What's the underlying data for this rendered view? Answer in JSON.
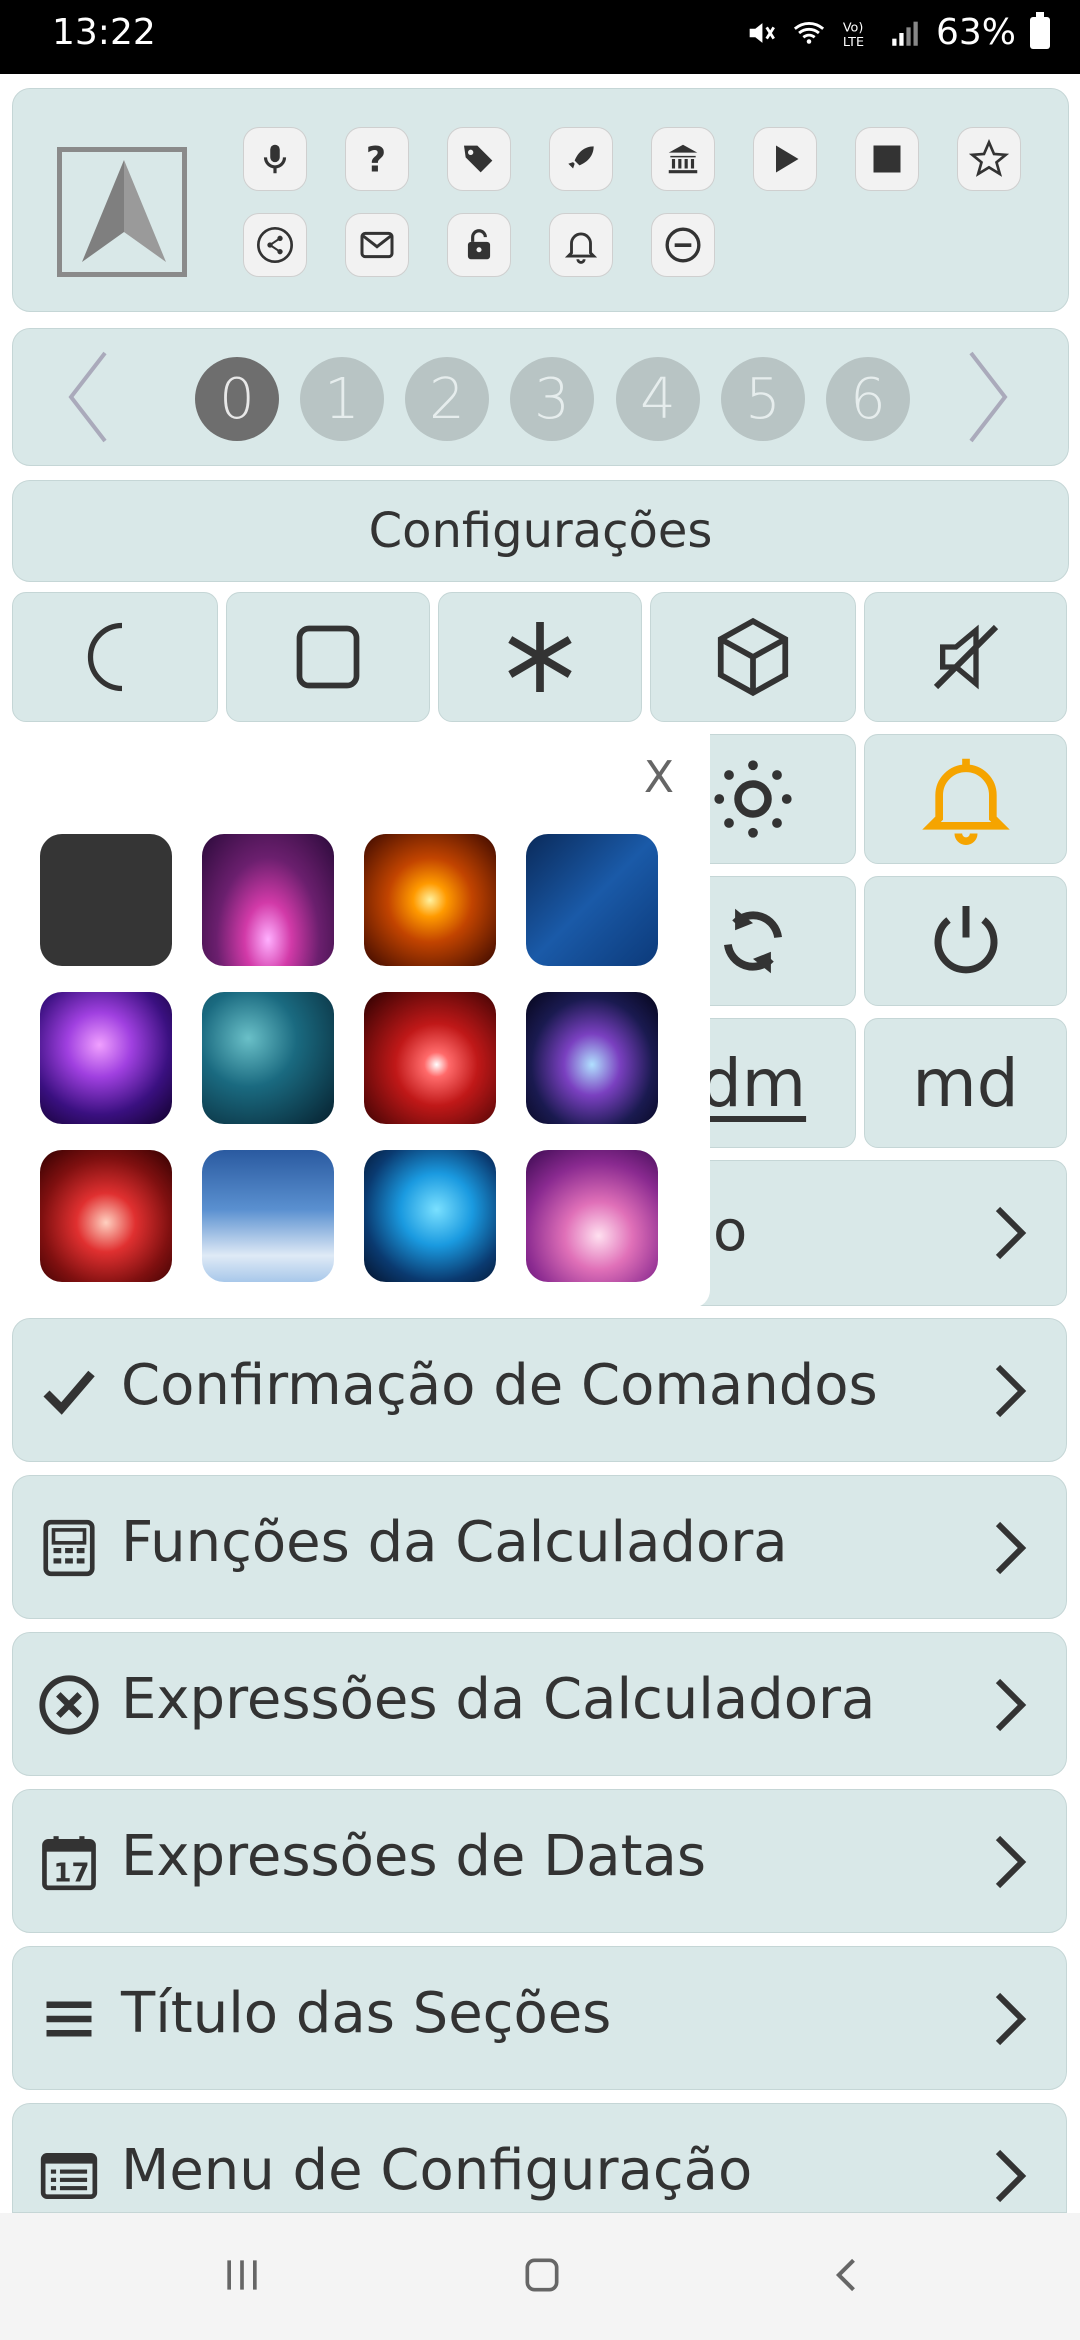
{
  "status_bar": {
    "time": "13:22",
    "battery": "63%"
  },
  "toolbar": {
    "icons": [
      "mic-icon",
      "help-icon",
      "tag-icon",
      "rocket-icon",
      "bank-icon",
      "play-icon",
      "stop-icon",
      "star-icon",
      "share-icon",
      "mail-icon",
      "unlock-icon",
      "bell-icon",
      "minus-circle-icon"
    ]
  },
  "pager": {
    "pages": [
      "0",
      "1",
      "2",
      "3",
      "4",
      "5",
      "6"
    ],
    "active": "0"
  },
  "section_title": "Configurações",
  "quick_tiles": {
    "row1": [
      "moon-icon",
      "square-icon",
      "asterisk-icon",
      "cube-icon",
      "mute-icon"
    ],
    "sun_icon": "sun-icon",
    "bell_icon": "bell-icon",
    "sync_icon": "sync-icon",
    "power_icon": "power-icon",
    "dm_label": "dm",
    "md_label": "md",
    "partial_row_text": "o"
  },
  "popup": {
    "close_label": "X",
    "swatches": [
      "dark-gray",
      "magenta-nebula",
      "orange-flare",
      "blue-polygon",
      "violet-glow",
      "teal-bokeh",
      "red-sparkle",
      "galaxy",
      "red-bokeh",
      "sky-clouds",
      "cyan-abstract",
      "pink-blur"
    ]
  },
  "menu": [
    {
      "icon": "check-icon",
      "label": "Confirmação de Comandos"
    },
    {
      "icon": "calculator-icon",
      "label": "Funções da Calculadora"
    },
    {
      "icon": "x-circle-icon",
      "label": "Expressões da Calculadora"
    },
    {
      "icon": "calendar-icon",
      "label": "Expressões de Datas",
      "calendar_day": "17"
    },
    {
      "icon": "list-icon",
      "label": "Título das Seções"
    },
    {
      "icon": "menu-list-icon",
      "label": "Menu de Configuração"
    }
  ],
  "colors": {
    "panel": "#d9e8e8",
    "accent_bell": "#f5a400",
    "dot_active": "#6e6e6e",
    "dot": "#b8c4c4"
  }
}
